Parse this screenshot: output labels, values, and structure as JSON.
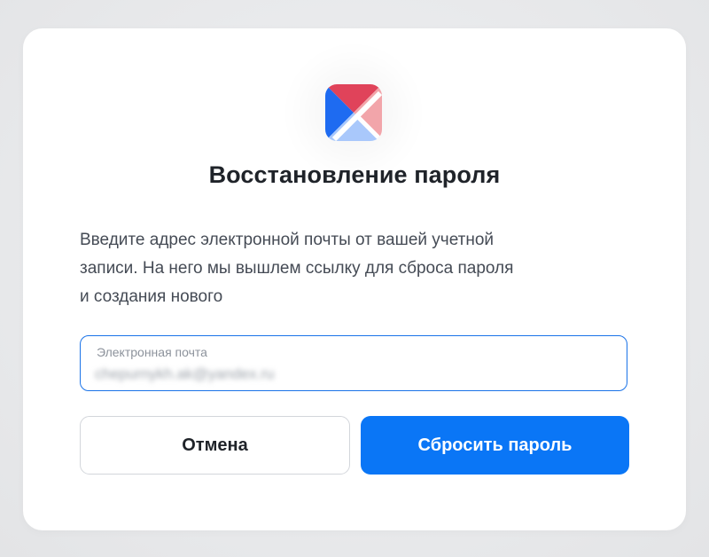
{
  "dialog": {
    "title": "Восстановление пароля",
    "description_lines": [
      "Введите адрес электронной почты от вашей учетной",
      "записи. На него мы вышлем ссылку для сброса пароля",
      "и создания нового"
    ],
    "email_field": {
      "label": "Электронная почта",
      "value": "chepurnykh.ak@yandex.ru",
      "state": "focused, value blurred"
    },
    "buttons": {
      "cancel_label": "Отмена",
      "reset_label": "Сбросить пароль"
    }
  },
  "logo": {
    "icon": "app-logo-icon",
    "colors": {
      "top": "#e0435a",
      "left": "#1e6bf1",
      "right": "#f2a5aa",
      "bottom": "#a9c8fb"
    }
  },
  "colors": {
    "accent": "#0a76f6",
    "field_border": "#1a73e8",
    "title": "#1f2329",
    "text": "#454b55"
  }
}
